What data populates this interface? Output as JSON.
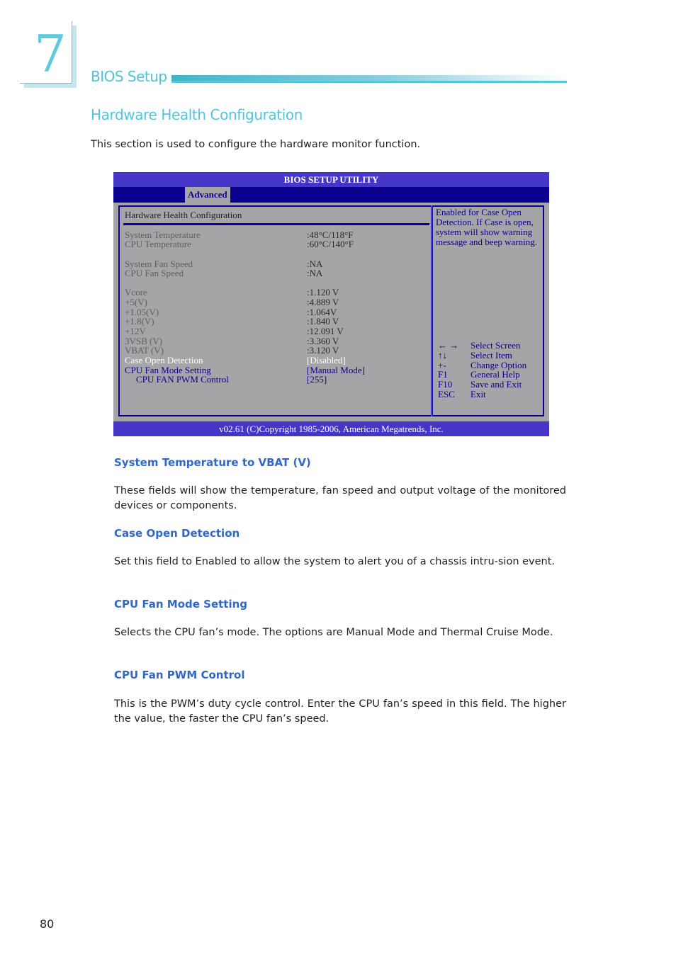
{
  "chapter": {
    "number": "7",
    "title": "BIOS Setup"
  },
  "section": {
    "title": "Hardware Health Configuration",
    "intro": "This section is used to configure the hardware monitor function."
  },
  "bios": {
    "title": "BIOS SETUP UTILITY",
    "active_tab": "Advanced",
    "heading": "Hardware Health Configuration",
    "rows": [
      {
        "label": "System Temperature",
        "value": ":48°C/118°F",
        "style": "gray"
      },
      {
        "label": "CPU Temperature",
        "value": ":60°C/140°F",
        "style": "gray"
      },
      {
        "label": "System Fan Speed",
        "value": ":NA",
        "style": "gray"
      },
      {
        "label": "CPU Fan Speed",
        "value": ":NA",
        "style": "gray"
      },
      {
        "label": "Vcore",
        "value": ":1.120 V",
        "style": "gray"
      },
      {
        "label": "+5(V)",
        "value": ":4.889 V",
        "style": "gray"
      },
      {
        "label": "+1.05(V)",
        "value": ":1.064V",
        "style": "gray"
      },
      {
        "label": "+1.8(V)",
        "value": ":1.840 V",
        "style": "gray"
      },
      {
        "label": "+12V",
        "value": ":12.091 V",
        "style": "gray"
      },
      {
        "label": "3VSB (V)",
        "value": ":3.360 V",
        "style": "gray"
      },
      {
        "label": "VBAT (V)",
        "value": ":3.120 V",
        "style": "gray"
      },
      {
        "label": "Case Open Detection",
        "value": "[Disabled]",
        "style": "selected"
      },
      {
        "label": "CPU Fan Mode Setting",
        "value": "[Manual Mode]",
        "style": "option"
      },
      {
        "label": "CPU FAN PWM Control",
        "value": "[255]",
        "style": "option"
      }
    ],
    "help_text": "Enabled for Case Open Detection. If Case is open, system will show warning message and beep warning.",
    "keys": [
      {
        "key": "← →",
        "desc": "Select Screen"
      },
      {
        "key": "↑↓",
        "desc": "Select Item"
      },
      {
        "key": "+-",
        "desc": "Change Option"
      },
      {
        "key": "F1",
        "desc": "General Help"
      },
      {
        "key": "F10",
        "desc": "Save and Exit"
      },
      {
        "key": "ESC",
        "desc": "Exit"
      }
    ],
    "footer": "v02.61 (C)Copyright 1985-2006, American Megatrends, Inc."
  },
  "descriptions": [
    {
      "title": "System Temperature to VBAT (V)",
      "text": "These fields will show the temperature, fan speed and output voltage of the monitored devices or components."
    },
    {
      "title": "Case Open Detection",
      "text": "Set this field to Enabled to allow the system to alert you of a chassis intru-sion event."
    },
    {
      "title": "CPU Fan Mode Setting",
      "text": "Selects the CPU fan’s mode. The options are Manual Mode and Thermal Cruise Mode."
    },
    {
      "title": "CPU Fan PWM Control",
      "text": "This is the PWM’s duty cycle control. Enter the CPU fan’s speed in this field. The higher the value, the faster the CPU fan’s speed."
    }
  ],
  "page_number": "80",
  "colors": {
    "accent_cyan": "#54c3dc",
    "heading_blue": "#3068c9",
    "bios_bar": "#4636c8",
    "bios_navy": "#0b0190",
    "bios_gray": "#a5a4a7"
  }
}
